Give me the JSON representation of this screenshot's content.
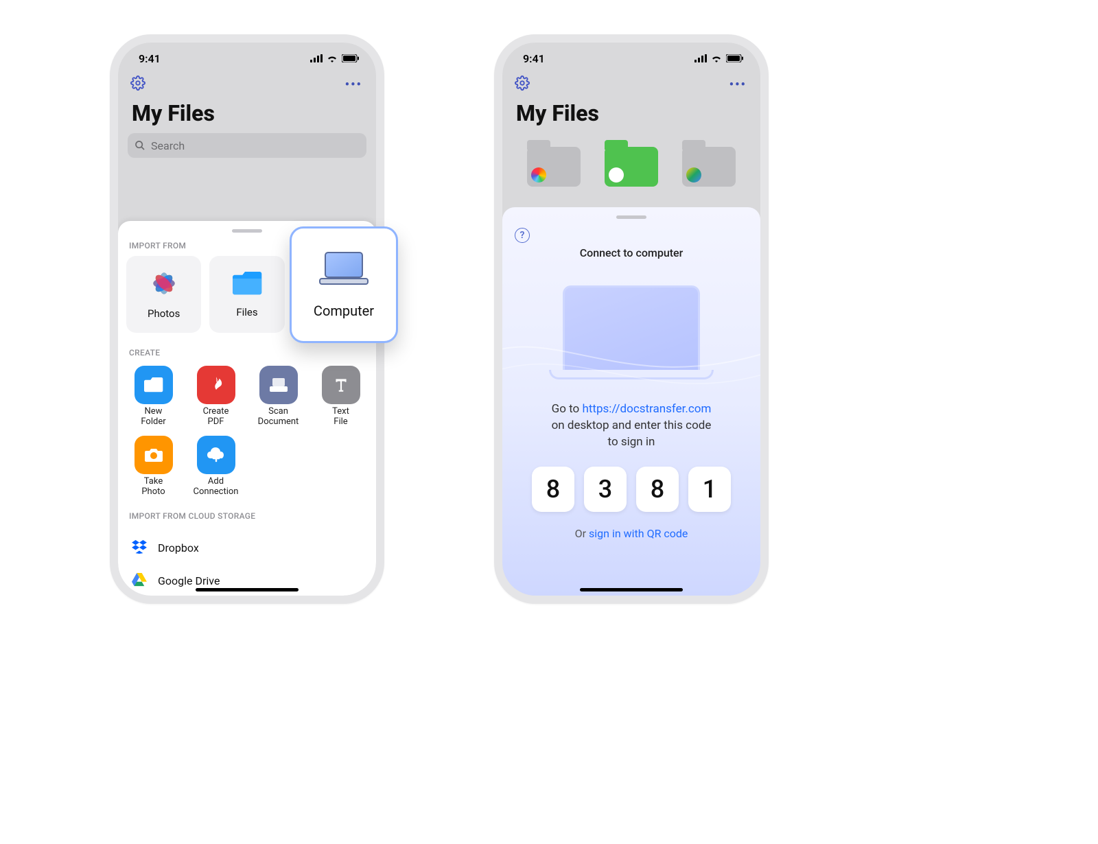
{
  "status": {
    "time": "9:41"
  },
  "header": {
    "title": "My Files"
  },
  "search": {
    "placeholder": "Search"
  },
  "sheetA": {
    "section_import_label": "IMPORT FROM",
    "import_items": [
      {
        "label": "Photos"
      },
      {
        "label": "Files"
      }
    ],
    "pop_card_label": "Computer",
    "section_create_label": "CREATE",
    "create_items": [
      {
        "label": "New\nFolder"
      },
      {
        "label": "Create\nPDF"
      },
      {
        "label": "Scan\nDocument"
      },
      {
        "label": "Text\nFile"
      },
      {
        "label": "Take\nPhoto"
      },
      {
        "label": "Add\nConnection"
      }
    ],
    "section_cloud_label": "IMPORT FROM CLOUD STORAGE",
    "cloud_items": [
      {
        "label": "Dropbox"
      },
      {
        "label": "Google Drive"
      }
    ]
  },
  "sheetB": {
    "title": "Connect to computer",
    "instruction_pre": "Go to ",
    "instruction_url": "https://docstransfer.com",
    "instruction_post1": "on desktop and enter this code",
    "instruction_post2": "to sign in",
    "code": [
      "8",
      "3",
      "8",
      "1"
    ],
    "alt_pre": "Or ",
    "alt_link": "sign in with QR code"
  }
}
